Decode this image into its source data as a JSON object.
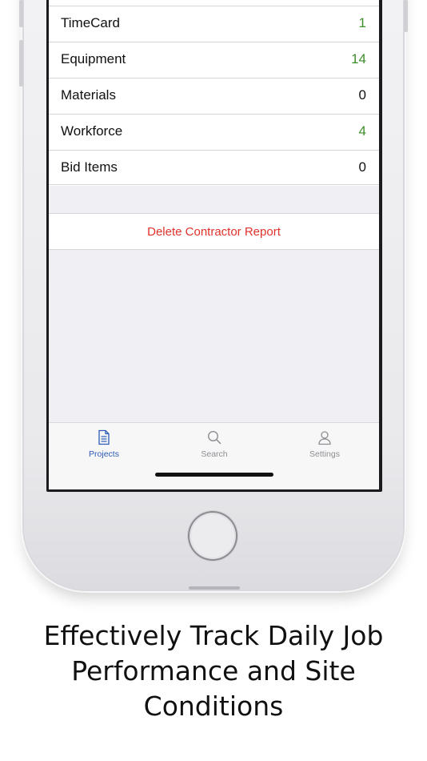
{
  "table": {
    "rows": [
      {
        "label": "TimeCard",
        "value": "1",
        "color": "#3f8e2c"
      },
      {
        "label": "Equipment",
        "value": "14",
        "color": "#3f8e2c"
      },
      {
        "label": "Materials",
        "value": "0",
        "color": "#111111"
      },
      {
        "label": "Workforce",
        "value": "4",
        "color": "#3f8e2c"
      },
      {
        "label": "Bid Items",
        "value": "0",
        "color": "#111111"
      }
    ]
  },
  "actions": {
    "delete_label": "Delete Contractor Report",
    "delete_color": "#e0322b"
  },
  "tabbar": {
    "tabs": [
      {
        "label": "Projects",
        "icon": "document-icon",
        "active": true
      },
      {
        "label": "Search",
        "icon": "search-icon",
        "active": false
      },
      {
        "label": "Settings",
        "icon": "person-icon",
        "active": false
      }
    ],
    "active_color": "#2c5ab6"
  },
  "caption": {
    "line1": "Effectively Track Daily Job",
    "line2": "Performance and Site",
    "line3": "Conditions"
  }
}
